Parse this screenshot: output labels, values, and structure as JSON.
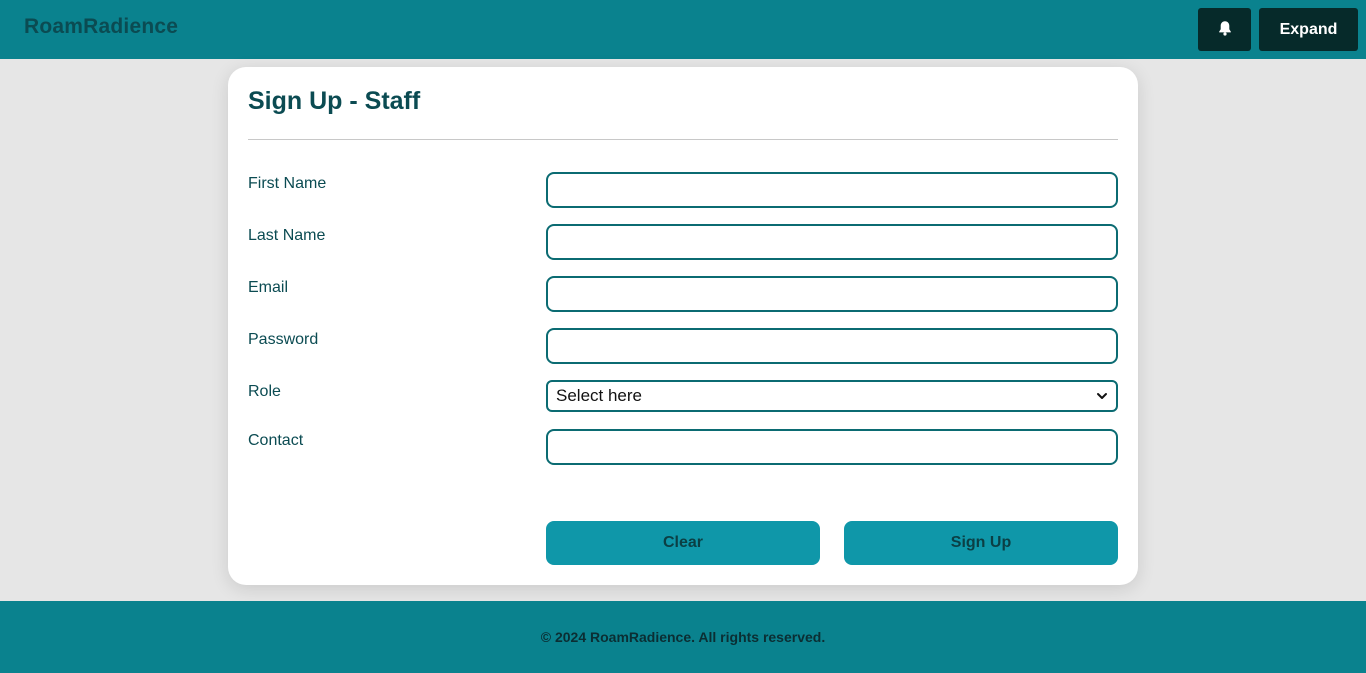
{
  "header": {
    "brand": "RoamRadience",
    "bell_icon": "bell-icon",
    "expand_label": "Expand"
  },
  "form": {
    "title": "Sign Up - Staff",
    "fields": [
      {
        "label": "First Name",
        "value": "",
        "placeholder": ""
      },
      {
        "label": "Last Name",
        "value": "",
        "placeholder": ""
      },
      {
        "label": "Email",
        "value": "",
        "placeholder": ""
      },
      {
        "label": "Password",
        "value": "",
        "placeholder": ""
      },
      {
        "label": "Role",
        "selected": "Select here"
      },
      {
        "label": "Contact",
        "value": "",
        "placeholder": ""
      }
    ],
    "clear_label": "Clear",
    "signup_label": "Sign Up"
  },
  "footer": {
    "text": "© 2024 RoamRadience. All rights reserved."
  },
  "colors": {
    "header_bg": "#0a828e",
    "brand_text": "#0b4b52",
    "dark_button": "#062a2a",
    "input_border": "#0b6b72",
    "action_button": "#0f97a9",
    "page_bg": "#e6e6e6"
  }
}
